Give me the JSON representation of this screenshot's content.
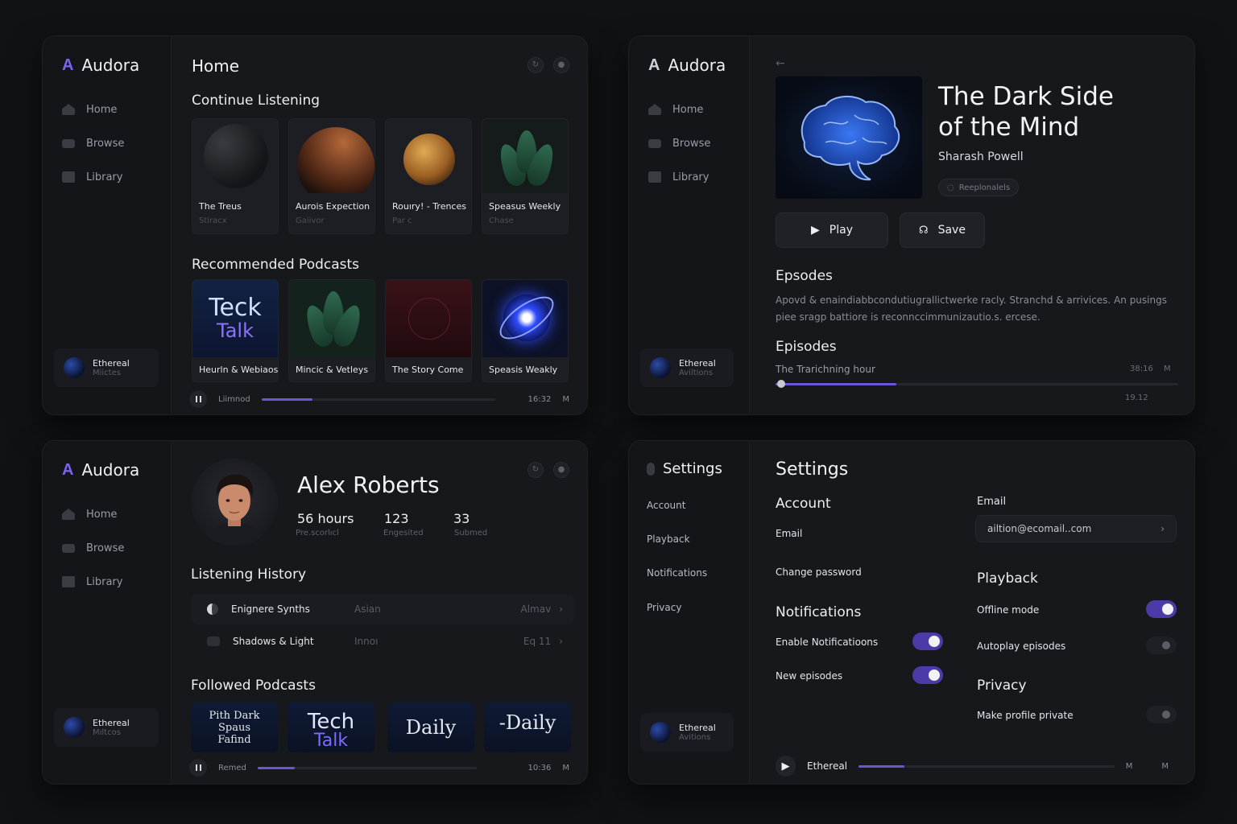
{
  "app": {
    "name": "Audora"
  },
  "nav": {
    "home": "Home",
    "browse": "Browse",
    "library": "Library"
  },
  "colors": {
    "accent": "#6a56d6",
    "background": "#111215",
    "panel": "#17181c"
  },
  "home": {
    "title": "Home",
    "continue_title": "Continue Listening",
    "continue": [
      {
        "title": "The Treus",
        "sub": "Stiracx"
      },
      {
        "title": "Aurois Expection",
        "sub": "Gaiivor"
      },
      {
        "title": "Rouıry! - Trences",
        "sub": "Par c"
      },
      {
        "title": "Speasus Weekly",
        "sub": "Chase"
      }
    ],
    "recommended_title": "Recommended Podcasts",
    "recommended": [
      {
        "title": "Heurln & Webiaos",
        "art_line1": "Teck",
        "art_line2": "Talk"
      },
      {
        "title": "Mincic & Vetleys"
      },
      {
        "title": "The Story Come"
      },
      {
        "title": "Speasis Weakly"
      }
    ],
    "mini": {
      "title": "Ethereal",
      "sub": "Miictes"
    },
    "player": {
      "label": "Liimnod",
      "time": "16:32",
      "end": "M",
      "progress": 0.22
    }
  },
  "detail": {
    "title_line1": "The Dark Side",
    "title_line2": "of the Mind",
    "author": "Sharash Powell",
    "chip": "Reeplonalels",
    "play_label": "Play",
    "save_label": "Save",
    "episodes_title": "Epsodes",
    "description_line1": "Apovd & enaindiabbcondutiugrallictwerke racly. Stranchd & arrivices. An pusings",
    "description_line2": "piee sragp  battiore is reconnccimmunizautio.s. ercese.",
    "episodes_title2": "Episodes",
    "episode": {
      "title": "The Trarichning hour",
      "time": "38:16",
      "end": "M",
      "sub_time": "19.12",
      "progress": 0.3
    },
    "mini": {
      "title": "Ethereal",
      "sub": "Aviltions"
    }
  },
  "profile": {
    "name": "Alex Roberts",
    "stats": [
      {
        "value": "56 hours",
        "label": "Pre.scorlıcl"
      },
      {
        "value": "123",
        "label": "Engesited"
      },
      {
        "value": "33",
        "label": "Submed"
      }
    ],
    "history_title": "Listening History",
    "history": [
      {
        "title": "Enignere Synths",
        "genre": "Asian",
        "right": "Almav"
      },
      {
        "title": "Shadows & Light",
        "genre": "Innoı",
        "right": "Eq 11"
      }
    ],
    "followed_title": "Followed Podcasts",
    "followed": [
      {
        "line1": "Pith Dark",
        "line2": "Spaus",
        "line3": "Fafind"
      },
      {
        "line1": "Tech",
        "line2": "Talk"
      },
      {
        "line1": "Daily"
      },
      {
        "line1": "-Daily"
      }
    ],
    "mini": {
      "title": "Ethereal",
      "sub": "Mıltcos"
    },
    "player": {
      "label": "Remed",
      "time": "10:36",
      "end": "M",
      "progress": 0.17
    }
  },
  "settings": {
    "side_title": "Settings",
    "side_items": [
      "Account",
      "Playback",
      "Notifications",
      "Privacy"
    ],
    "title": "Settings",
    "account_title": "Account",
    "email_label": "Email",
    "change_password": "Change password",
    "notifications_title": "Notifications",
    "enable_notifications": "Enable Notificatioons",
    "new_episodes": "New episodes",
    "email_field_label": "Email",
    "email_value": "ailtion@ecomail..com",
    "playback_title": "Playback",
    "offline_mode": "Offline mode",
    "autoplay": "Autoplay episodes",
    "privacy_title": "Privacy",
    "make_private": "Make profile private",
    "mini": {
      "title": "Ethereal",
      "sub": "Avitions"
    },
    "player": {
      "label": "Ethereal",
      "end1": "M",
      "end2": "M",
      "progress": 0.18
    }
  }
}
